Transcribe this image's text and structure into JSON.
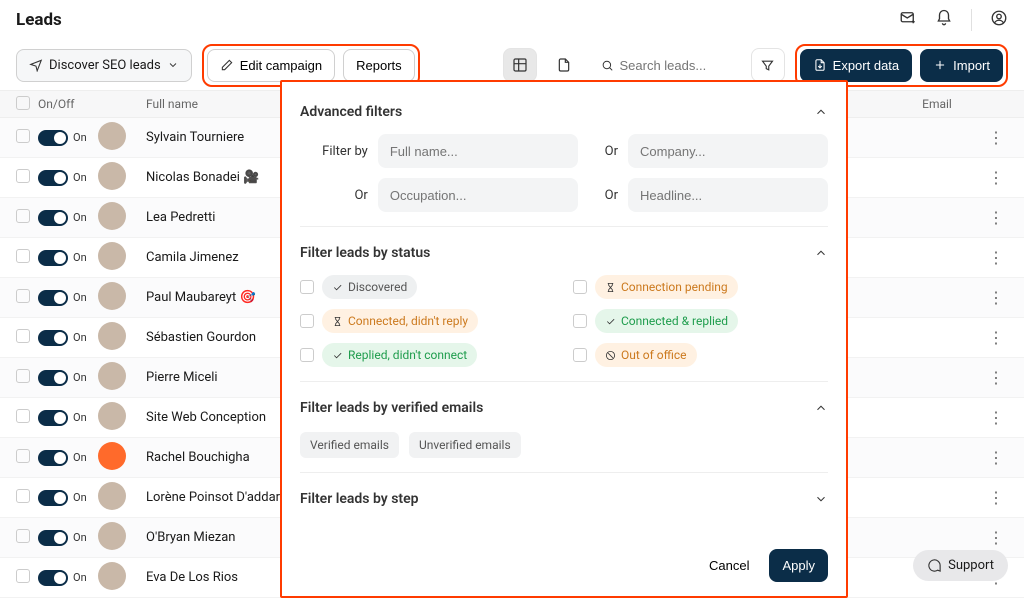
{
  "header": {
    "title": "Leads"
  },
  "toolbar": {
    "campaign_selector": "Discover SEO leads",
    "edit_campaign": "Edit campaign",
    "reports": "Reports",
    "search_placeholder": "Search leads...",
    "export": "Export data",
    "import": "Import"
  },
  "table": {
    "columns": {
      "onoff": "On/Off",
      "fullname": "Full name",
      "email": "Email"
    },
    "rows": [
      {
        "on": "On",
        "name": "Sylvain Tourniere"
      },
      {
        "on": "On",
        "name": "Nicolas Bonadei 🎥"
      },
      {
        "on": "On",
        "name": "Lea Pedretti"
      },
      {
        "on": "On",
        "name": "Camila Jimenez"
      },
      {
        "on": "On",
        "name": "Paul Maubareyt 🎯"
      },
      {
        "on": "On",
        "name": "Sébastien Gourdon"
      },
      {
        "on": "On",
        "name": "Pierre Miceli"
      },
      {
        "on": "On",
        "name": "Site Web Conception"
      },
      {
        "on": "On",
        "name": "Rachel Bouchigha"
      },
      {
        "on": "On",
        "name": "Lorène Poinsot D'addario"
      },
      {
        "on": "On",
        "name": "O'Bryan Miezan"
      },
      {
        "on": "On",
        "name": "Eva De Los Rios"
      }
    ]
  },
  "panel": {
    "advanced": {
      "title": "Advanced filters",
      "filter_by": "Filter by",
      "or": "Or",
      "fullname_ph": "Full name...",
      "company_ph": "Company...",
      "occupation_ph": "Occupation...",
      "headline_ph": "Headline..."
    },
    "status": {
      "title": "Filter leads by status",
      "discovered": "Discovered",
      "connection_pending": "Connection pending",
      "connected_no_reply": "Connected, didn't reply",
      "connected_replied": "Connected & replied",
      "replied_no_connect": "Replied, didn't connect",
      "out_of_office": "Out of office"
    },
    "verified": {
      "title": "Filter leads by verified emails",
      "verified": "Verified emails",
      "unverified": "Unverified emails"
    },
    "step": {
      "title": "Filter leads by step"
    },
    "footer": {
      "cancel": "Cancel",
      "apply": "Apply"
    }
  },
  "support": "Support"
}
